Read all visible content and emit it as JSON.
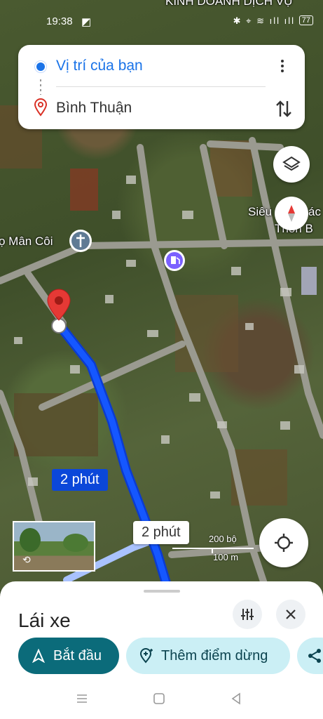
{
  "status_bar": {
    "time": "19:38",
    "battery": "77"
  },
  "map": {
    "labels": {
      "top": "KINH DOANH DỊCH VỤ",
      "church": "ọ Mân Côi",
      "shop_line1": "Siêu",
      "shop_line1b": "ác",
      "shop_line2": "Thôn B"
    },
    "route_colors": {
      "primary": "#1557ff",
      "alternate": "#a9c2ff"
    }
  },
  "directions": {
    "origin": "Vị trí của bạn",
    "destination": "Bình Thuận"
  },
  "route_badges": {
    "primary": "2 phút",
    "alternate": "2 phút"
  },
  "scale": {
    "feet": "200 bộ",
    "meters": "100 m"
  },
  "sheet": {
    "mode_title": "Lái xe",
    "start_label": "Bắt đầu",
    "add_stop_label": "Thêm điểm dừng"
  },
  "colors": {
    "start_button": "#0b6b7a",
    "secondary_button": "#cbeff5",
    "accent_blue": "#1a73e8"
  }
}
